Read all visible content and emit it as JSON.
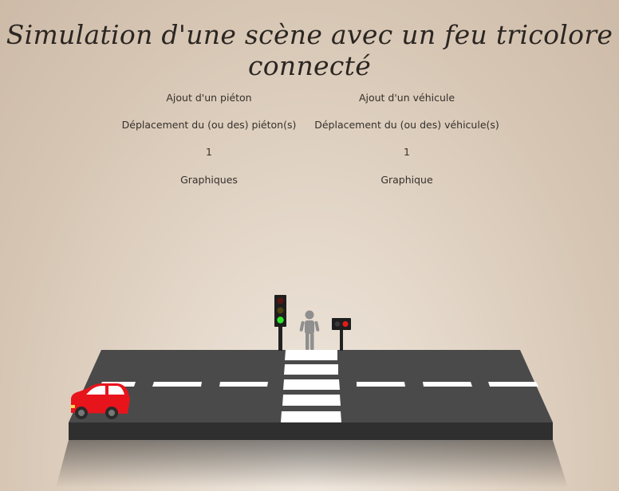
{
  "page": {
    "title": "Simulation d'une scène avec un feu tricolore connecté"
  },
  "pedestrian_panel": {
    "add_label": "Ajout d'un piéton",
    "move_label": "Déplacement du (ou des) piéton(s)",
    "count": "1",
    "charts_label": "Graphiques"
  },
  "vehicle_panel": {
    "add_label": "Ajout d'un véhicule",
    "move_label": "Déplacement du (ou des) véhicule(s)",
    "count": "1",
    "chart_label": "Graphique"
  },
  "scene": {
    "traffic_light_state": "green",
    "pedestrian_light_state": "red",
    "car_color": "#e8141c",
    "colors": {
      "road_top": "#4a4a4a",
      "road_side": "#2f2f2f",
      "lane_marking": "#ffffff",
      "light_red_on": "#e11b1b",
      "light_red_off": "#5a1414",
      "light_amber_off": "#4e4412",
      "light_green_on": "#2ee62e",
      "pedestrian": "#8f8f8f"
    }
  }
}
